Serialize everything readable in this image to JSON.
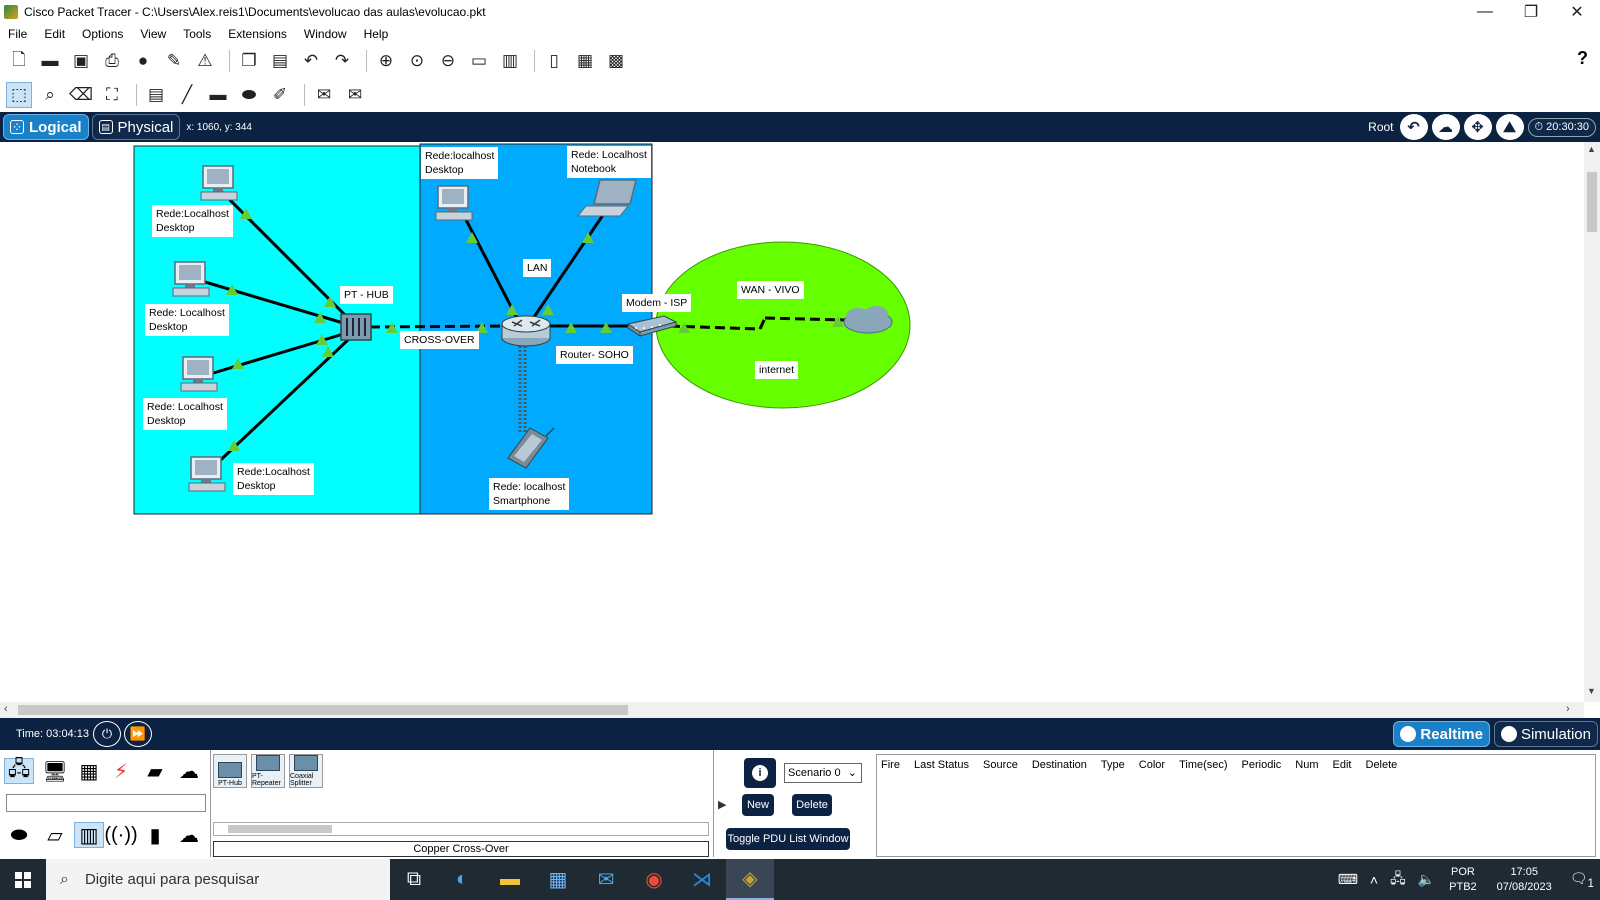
{
  "window": {
    "title": "Cisco Packet Tracer - C:\\Users\\Alex.reis1\\Documents\\evolucao das aulas\\evolucao.pkt",
    "minimize": "—",
    "restore": "❐",
    "close": "✕"
  },
  "menu": [
    "File",
    "Edit",
    "Options",
    "View",
    "Tools",
    "Extensions",
    "Window",
    "Help"
  ],
  "help_label": "?",
  "workspace": {
    "logical_label": "Logical",
    "physical_label": "Physical",
    "coords": "x: 1060, y: 344",
    "root_label": "Root",
    "clock": "20:30:30"
  },
  "topology": {
    "labels": {
      "hub_pc1": "Rede:Localhost\nDesktop",
      "hub_pc2": "Rede: Localhost\nDesktop",
      "hub_pc3": "Rede: Localhost\nDesktop",
      "hub_pc4": "Rede:Localhost\nDesktop",
      "hub": "PT - HUB",
      "crossover": "CROSS-OVER",
      "lan_desktop": "Rede:localhost\nDesktop",
      "lan_notebook": "Rede: Localhost\nNotebook",
      "lan": "LAN",
      "router": "Router- SOHO",
      "modem": "Modem - ISP",
      "smartphone": "Rede: localhost\nSmartphone",
      "wan": "WAN - VIVO",
      "internet": "internet"
    },
    "colors": {
      "hub_area": "#00ffff",
      "lan_area": "#00aaff",
      "wan_area": "#66ff00",
      "link_indicator": "#66cc33"
    }
  },
  "status": {
    "time": "Time: 03:04:13",
    "realtime_label": "Realtime",
    "simulation_label": "Simulation"
  },
  "device_panel": {
    "items": [
      "PT-Hub",
      "PT-Repeater",
      "Coaxial Splitter"
    ],
    "caption": "Copper Cross-Over"
  },
  "scenario": {
    "selected": "Scenario 0",
    "new_label": "New",
    "delete_label": "Delete",
    "toggle_label": "Toggle PDU List Window"
  },
  "pdu_columns": [
    "Fire",
    "Last Status",
    "Source",
    "Destination",
    "Type",
    "Color",
    "Time(sec)",
    "Periodic",
    "Num",
    "Edit",
    "Delete"
  ],
  "taskbar": {
    "search_placeholder": "Digite aqui para pesquisar",
    "lang_top": "POR",
    "lang_bottom": "PTB2",
    "time": "17:05",
    "date": "07/08/2023",
    "notification_count": "1"
  }
}
